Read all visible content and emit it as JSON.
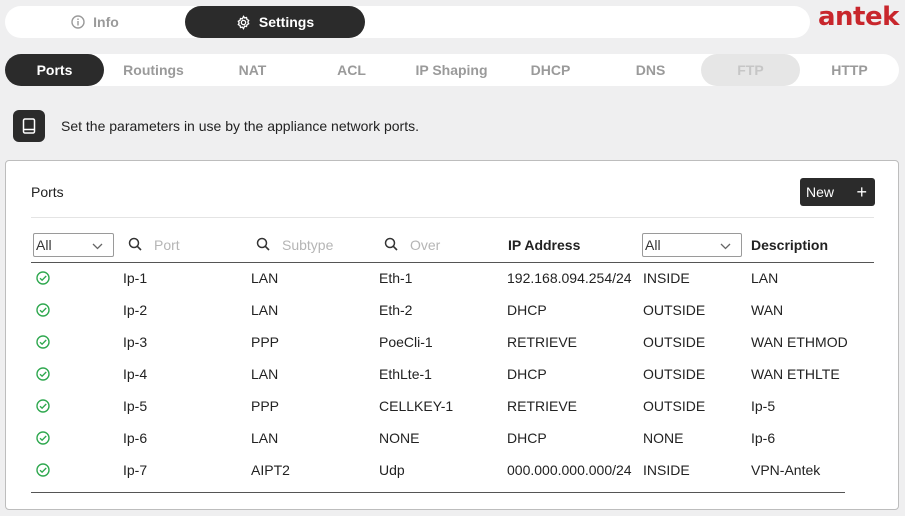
{
  "top_tabs": [
    {
      "label": "Info",
      "icon": "info-circle-icon"
    },
    {
      "label": "Settings",
      "icon": "gear-icon"
    }
  ],
  "logo_text": "antek",
  "colors": {
    "accent": "#2b2b2b",
    "brand": "#c8262c",
    "status_ok": "#2fa84f"
  },
  "sub_tabs": [
    {
      "label": "Ports",
      "state": "active"
    },
    {
      "label": "Routings",
      "state": "normal"
    },
    {
      "label": "NAT",
      "state": "normal"
    },
    {
      "label": "ACL",
      "state": "normal"
    },
    {
      "label": "IP Shaping",
      "state": "normal"
    },
    {
      "label": "DHCP",
      "state": "normal"
    },
    {
      "label": "DNS",
      "state": "normal"
    },
    {
      "label": "FTP",
      "state": "disabled"
    },
    {
      "label": "HTTP",
      "state": "normal"
    }
  ],
  "info": {
    "icon": "book-icon",
    "text": "Set the parameters in use by the appliance network ports."
  },
  "panel": {
    "title": "Ports",
    "new_button": {
      "label": "New",
      "icon": "plus-icon"
    },
    "filters": {
      "status_select": "All",
      "port_placeholder": "Port",
      "subtype_placeholder": "Subtype",
      "over_placeholder": "Over",
      "ip_header": "IP Address",
      "zone_select": "All",
      "description_header": "Description"
    },
    "rows": [
      {
        "status": "check-circle-icon",
        "port": "Ip-1",
        "subtype": "LAN",
        "over": "Eth-1",
        "ip": "192.168.094.254/24",
        "zone": "INSIDE",
        "description": "LAN"
      },
      {
        "status": "check-circle-icon",
        "port": "Ip-2",
        "subtype": "LAN",
        "over": "Eth-2",
        "ip": "DHCP",
        "zone": "OUTSIDE",
        "description": "WAN"
      },
      {
        "status": "check-circle-icon",
        "port": "Ip-3",
        "subtype": "PPP",
        "over": "PoeCli-1",
        "ip": "RETRIEVE",
        "zone": "OUTSIDE",
        "description": "WAN ETHMOD"
      },
      {
        "status": "check-circle-icon",
        "port": "Ip-4",
        "subtype": "LAN",
        "over": "EthLte-1",
        "ip": "DHCP",
        "zone": "OUTSIDE",
        "description": "WAN ETHLTE"
      },
      {
        "status": "check-circle-icon",
        "port": "Ip-5",
        "subtype": "PPP",
        "over": "CELLKEY-1",
        "ip": "RETRIEVE",
        "zone": "OUTSIDE",
        "description": "Ip-5"
      },
      {
        "status": "check-circle-icon",
        "port": "Ip-6",
        "subtype": "LAN",
        "over": "NONE",
        "ip": "DHCP",
        "zone": "NONE",
        "description": "Ip-6"
      },
      {
        "status": "check-circle-icon",
        "port": "Ip-7",
        "subtype": "AIPT2",
        "over": "Udp",
        "ip": "000.000.000.000/24",
        "zone": "INSIDE",
        "description": "VPN-Antek"
      }
    ]
  }
}
